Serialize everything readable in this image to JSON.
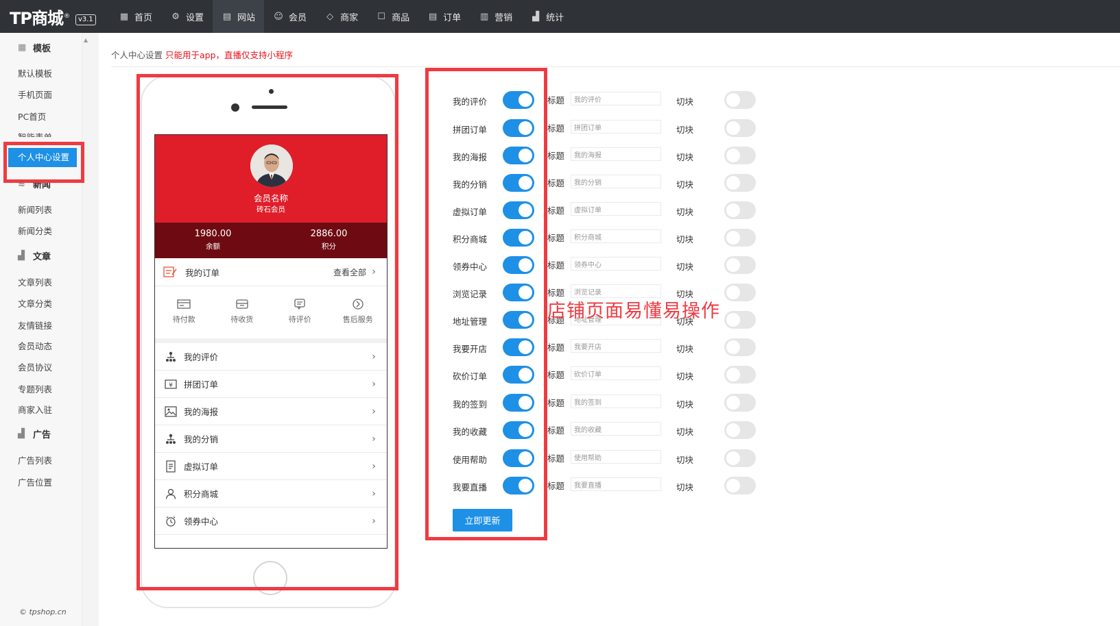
{
  "brand": {
    "logo": "TP商城",
    "reg": "®",
    "version": "v3.1"
  },
  "nav": [
    {
      "label": "首页",
      "icon": "dashboard-icon"
    },
    {
      "label": "设置",
      "icon": "gear-icon"
    },
    {
      "label": "网站",
      "icon": "website-icon"
    },
    {
      "label": "会员",
      "icon": "users-icon"
    },
    {
      "label": "商家",
      "icon": "diamond-icon"
    },
    {
      "label": "商品",
      "icon": "bag-icon"
    },
    {
      "label": "订单",
      "icon": "order-icon"
    },
    {
      "label": "营销",
      "icon": "chart-icon"
    },
    {
      "label": "统计",
      "icon": "bar-chart-icon"
    }
  ],
  "sidebar": {
    "sections": [
      {
        "label": "模板",
        "icon": "grid-icon"
      },
      {
        "label": "新闻",
        "icon": "layers-icon"
      },
      {
        "label": "文章",
        "icon": "chart-icon"
      },
      {
        "label": "广告",
        "icon": "chart-icon"
      }
    ],
    "items": [
      "默认模板",
      "手机页面",
      "PC首页",
      "智能表单",
      "个人中心设置",
      "新闻列表",
      "新闻分类",
      "文章列表",
      "文章分类",
      "友情链接",
      "会员动态",
      "会员协议",
      "专题列表",
      "商家入驻",
      "广告列表",
      "广告位置"
    ],
    "footer": "© tpshop.cn"
  },
  "breadcrumb": {
    "title": "个人中心设置",
    "hint": "只能用于app，直播仅支持小程序"
  },
  "phone": {
    "member_name": "会员名称",
    "member_level": "砖石会员",
    "balance_value": "1980.00",
    "balance_label": "余额",
    "points_value": "2886.00",
    "points_label": "积分",
    "orders_title": "我的订单",
    "orders_all": "查看全部",
    "order_states": [
      "待付款",
      "待收货",
      "待评价",
      "售后服务"
    ],
    "menu": [
      "我的评价",
      "拼团订单",
      "我的海报",
      "我的分销",
      "虚拟订单",
      "积分商城",
      "领券中心"
    ]
  },
  "settings": {
    "title_label": "标题",
    "switch_label": "切块",
    "rows": [
      {
        "name": "我的评价",
        "value": "我的评价"
      },
      {
        "name": "拼团订单",
        "value": "拼团订单"
      },
      {
        "name": "我的海报",
        "value": "我的海报"
      },
      {
        "name": "我的分销",
        "value": "我的分销"
      },
      {
        "name": "虚拟订单",
        "value": "虚拟订单"
      },
      {
        "name": "积分商城",
        "value": "积分商城"
      },
      {
        "name": "领券中心",
        "value": "领券中心"
      },
      {
        "name": "浏览记录",
        "value": "浏览记录"
      },
      {
        "name": "地址管理",
        "value": "地址管理"
      },
      {
        "name": "我要开店",
        "value": "我要开店"
      },
      {
        "name": "砍价订单",
        "value": "砍价订单"
      },
      {
        "name": "我的签到",
        "value": "我的签到"
      },
      {
        "name": "我的收藏",
        "value": "我的收藏"
      },
      {
        "name": "使用帮助",
        "value": "使用帮助"
      },
      {
        "name": "我要直播",
        "value": "我要直播"
      }
    ],
    "update_button": "立即更新"
  },
  "overlay": "店铺页面易懂易操作",
  "colors": {
    "accent": "#1e90e6",
    "red": "#e01e2a",
    "highlight_border": "#ee3b42",
    "topbar": "#2f3236"
  }
}
